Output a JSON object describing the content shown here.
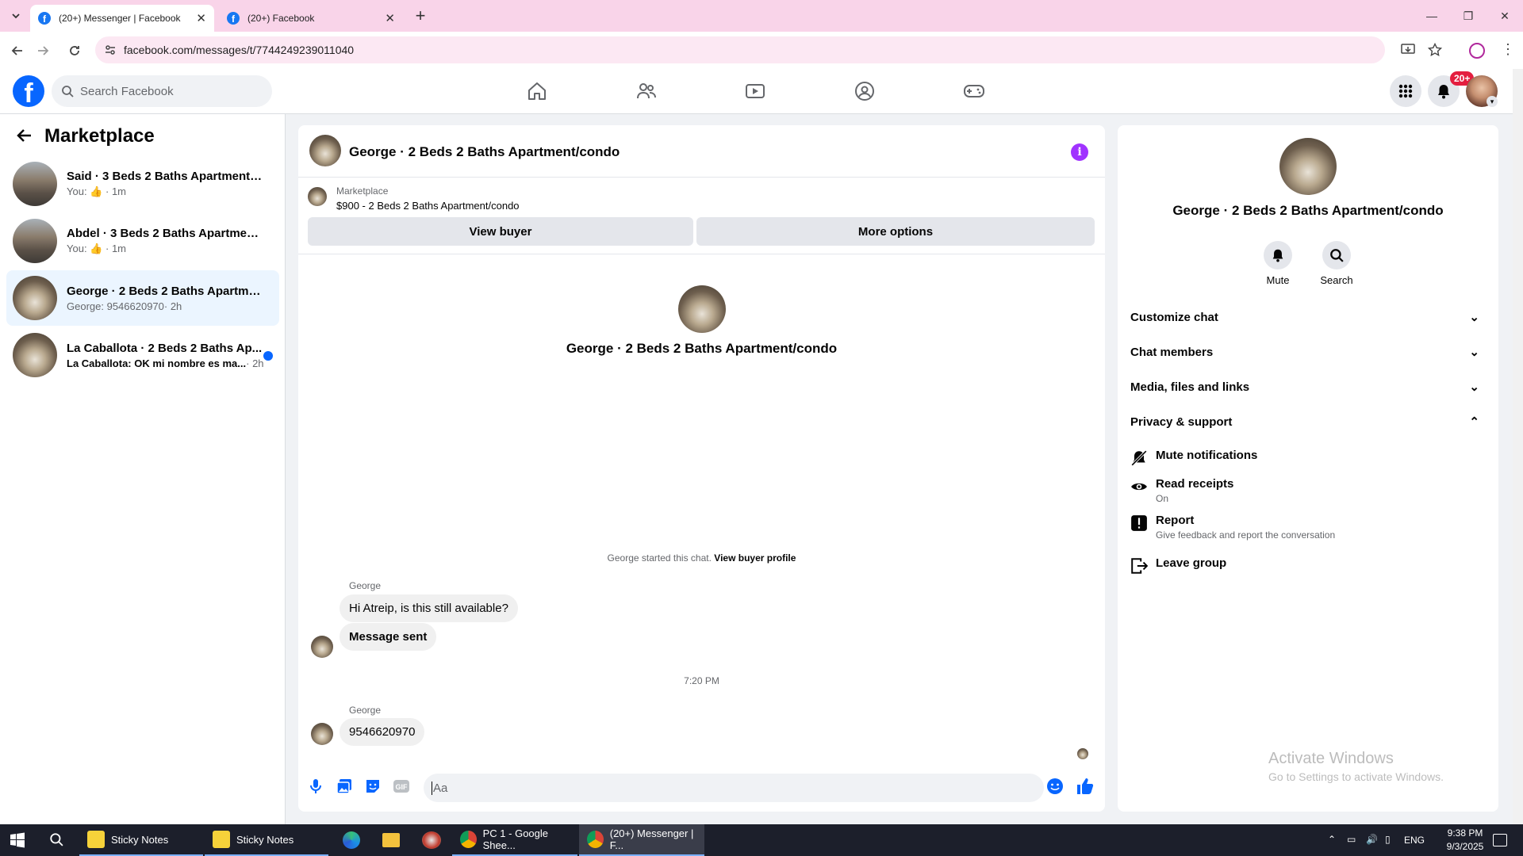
{
  "browser": {
    "tabs": [
      {
        "title": "(20+) Messenger | Facebook",
        "active": true
      },
      {
        "title": "(20+) Facebook",
        "active": false
      }
    ],
    "new_tab": "+",
    "url": "facebook.com/messages/t/7744249239011040"
  },
  "fb": {
    "logo": "f",
    "search_placeholder": "Search Facebook",
    "notif_badge": "20+",
    "colors": {
      "brand": "#0866ff",
      "badge": "#e41e3f",
      "selected": "#ebf5ff"
    }
  },
  "sidebar": {
    "title": "Marketplace",
    "conversations": [
      {
        "name": "Said · 3 Beds 2 Baths Apartment/c...",
        "preview_prefix": "You:",
        "preview_suffix": "· 1m",
        "has_like": true,
        "unread": false,
        "selected": false
      },
      {
        "name": "Abdel · 3 Beds 2 Baths Apartment/...",
        "preview_prefix": "You:",
        "preview_suffix": "· 1m",
        "has_like": true,
        "unread": false,
        "selected": false
      },
      {
        "name": "George · 2 Beds 2 Baths Apartmen...",
        "preview_prefix": "George: 9546620970",
        "preview_suffix": "· 2h",
        "has_like": false,
        "unread": false,
        "selected": true
      },
      {
        "name": "La Caballota · 2 Beds 2 Baths Ap...",
        "preview_prefix": "La Caballota: OK mi nombre es ma...",
        "preview_suffix": "· 2h",
        "has_like": false,
        "unread": true,
        "selected": false
      }
    ]
  },
  "chat": {
    "title": "George · 2 Beds 2 Baths Apartment/condo",
    "listing_source": "Marketplace",
    "listing_price": "$900 - 2 Beds 2 Baths Apartment/condo",
    "view_buyer": "View buyer",
    "more_options": "More options",
    "intro_name": "George · 2 Beds 2 Baths Apartment/condo",
    "started_text": "George started this chat.",
    "view_buyer_profile": "View buyer profile",
    "sender1": "George",
    "msg1": "Hi Atreip, is this still available?",
    "msg2": "Message sent",
    "timestamp": "7:20 PM",
    "sender2": "George",
    "msg3": "9546620970",
    "composer_placeholder": "Aa"
  },
  "details": {
    "title": "George · 2 Beds 2 Baths Apartment/condo",
    "mute_label": "Mute",
    "search_label": "Search",
    "sections": [
      "Customize chat",
      "Chat members",
      "Media, files and links",
      "Privacy & support"
    ],
    "privacy_items": [
      {
        "title": "Mute notifications",
        "sub": "",
        "icon": "bell-off-icon"
      },
      {
        "title": "Read receipts",
        "sub": "On",
        "icon": "eye-icon"
      },
      {
        "title": "Report",
        "sub": "Give feedback and report the conversation",
        "icon": "alert-icon"
      },
      {
        "title": "Leave group",
        "sub": "",
        "icon": "leave-icon"
      }
    ],
    "watermark_title": "Activate Windows",
    "watermark_sub": "Go to Settings to activate Windows."
  },
  "taskbar": {
    "apps": [
      {
        "label": "Sticky Notes"
      },
      {
        "label": "Sticky Notes"
      },
      {
        "label": "PC 1 - Google Shee..."
      },
      {
        "label": "(20+) Messenger | F..."
      }
    ],
    "lang": "ENG",
    "time": "9:38 PM",
    "date": "9/3/2025"
  }
}
